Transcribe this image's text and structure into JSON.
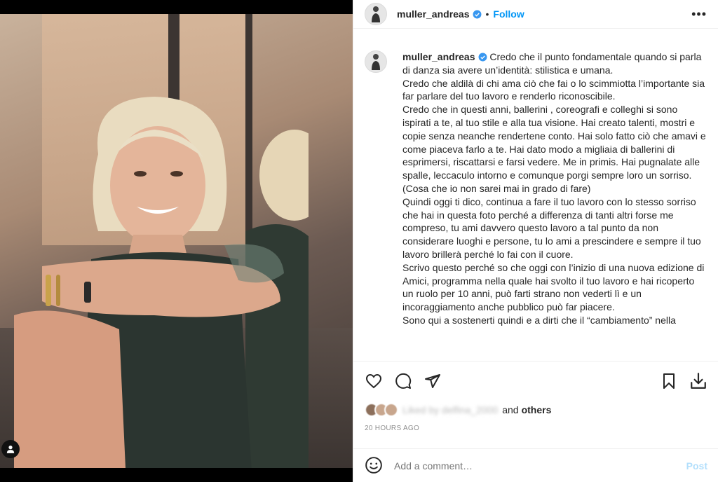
{
  "post": {
    "username": "muller_andreas",
    "follow_label": "Follow",
    "more_icon": "more-options-icon",
    "caption_paragraphs": [
      "Credo che il punto fondamentale quando si parla di danza sia avere un’identità: stilistica e umana.",
      "Credo che aldilà di chi ama ciò che fai o lo scimmiotta l’importante sia far parlare del tuo lavoro e renderlo riconoscibile.",
      "Credo che in questi anni, ballerini , coreografi e colleghi si sono ispirati a te, al tuo stile e alla tua visione. Hai creato talenti, mostri e copie senza neanche rendertene conto. Hai solo fatto ciò che amavi e come piaceva farlo a te. Hai dato modo a migliaia di ballerini di esprimersi, riscattarsi e farsi vedere. Me in primis. Hai pugnalate alle spalle, leccaculo intorno e comunque porgi sempre loro un sorriso. (Cosa che io non sarei mai in grado di fare)",
      "Quindi oggi ti dico, continua a fare il tuo lavoro con lo stesso sorriso che hai in questa foto perché a differenza di tanti altri forse me compreso, tu ami davvero questo lavoro a tal punto da non considerare luoghi e persone, tu lo ami a prescindere e sempre il tuo lavoro brillerà perché lo fai con il cuore.",
      "Scrivo questo perché so che oggi con l’inizio di una nuova edizione di Amici, programma nella quale hai svolto il tuo lavoro e hai ricoperto un ruolo per 10 anni, può farti strano non vederti lì e un incoraggiamento anche pubblico può far piacere.",
      "Sono qui a sostenerti quindi e a dirti che il “cambiamento” nella"
    ],
    "likes": {
      "blurred_text": "Liked by delfina_2000",
      "and_text": "and",
      "others_text": "others"
    },
    "timestamp": "20 HOURS AGO",
    "comment": {
      "placeholder": "Add a comment…",
      "post_label": "Post"
    }
  },
  "colors": {
    "accent": "#0095f6",
    "post_disabled": "#b2dffc",
    "muted": "#8e8e8e",
    "text": "#262626"
  }
}
